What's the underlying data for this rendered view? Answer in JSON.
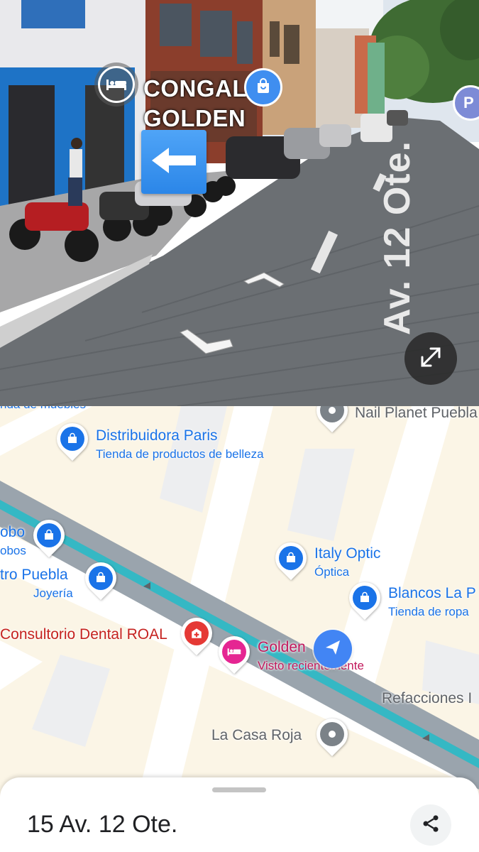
{
  "street_view": {
    "place_label_line1": "CONGAL",
    "place_label_line2": "GOLDEN",
    "street_name": "Av. 12 Ote.",
    "icons": {
      "hotel": "bed-icon",
      "shop": "shopping-bag-icon",
      "direction": "arrow-left-icon",
      "parking": "parking-icon",
      "expand": "expand-icon"
    },
    "parking_letter": "P"
  },
  "map": {
    "pois": [
      {
        "title": "Nail Planet Puebla",
        "subtitle": "",
        "color": "#5f6368"
      },
      {
        "title": "Distribuidora Paris",
        "subtitle": "Tienda de productos de belleza",
        "color": "#1a73e8"
      },
      {
        "title": "obo",
        "subtitle": "obos",
        "color": "#1a73e8"
      },
      {
        "title": "tro Puebla",
        "subtitle": "Joyería",
        "color": "#1a73e8"
      },
      {
        "title": "Italy Optic",
        "subtitle": "Óptica",
        "color": "#1a73e8"
      },
      {
        "title": "Blancos La P",
        "subtitle": "Tienda de ropa",
        "color": "#1a73e8"
      },
      {
        "title": "Consultorio Dental ROAL",
        "subtitle": "",
        "color": "#c5221f"
      },
      {
        "title": "Golden",
        "subtitle": "Visto recientemente",
        "color": "#c2185b"
      },
      {
        "title": "Refacciones I",
        "subtitle": "",
        "color": "#5f6368"
      },
      {
        "title": "La Casa Roja",
        "subtitle": "",
        "color": "#5f6368"
      },
      {
        "title": "nda de muebles",
        "subtitle": "",
        "color": "#1a73e8"
      }
    ]
  },
  "sheet": {
    "address": "15 Av. 12 Ote.",
    "share_icon": "share-icon"
  },
  "colors": {
    "shop_blue": "#1a73e8",
    "dental_red": "#e53935",
    "hotel_pink": "#e52592",
    "route_teal": "#35b8c4",
    "location_blue": "#4285f4"
  }
}
